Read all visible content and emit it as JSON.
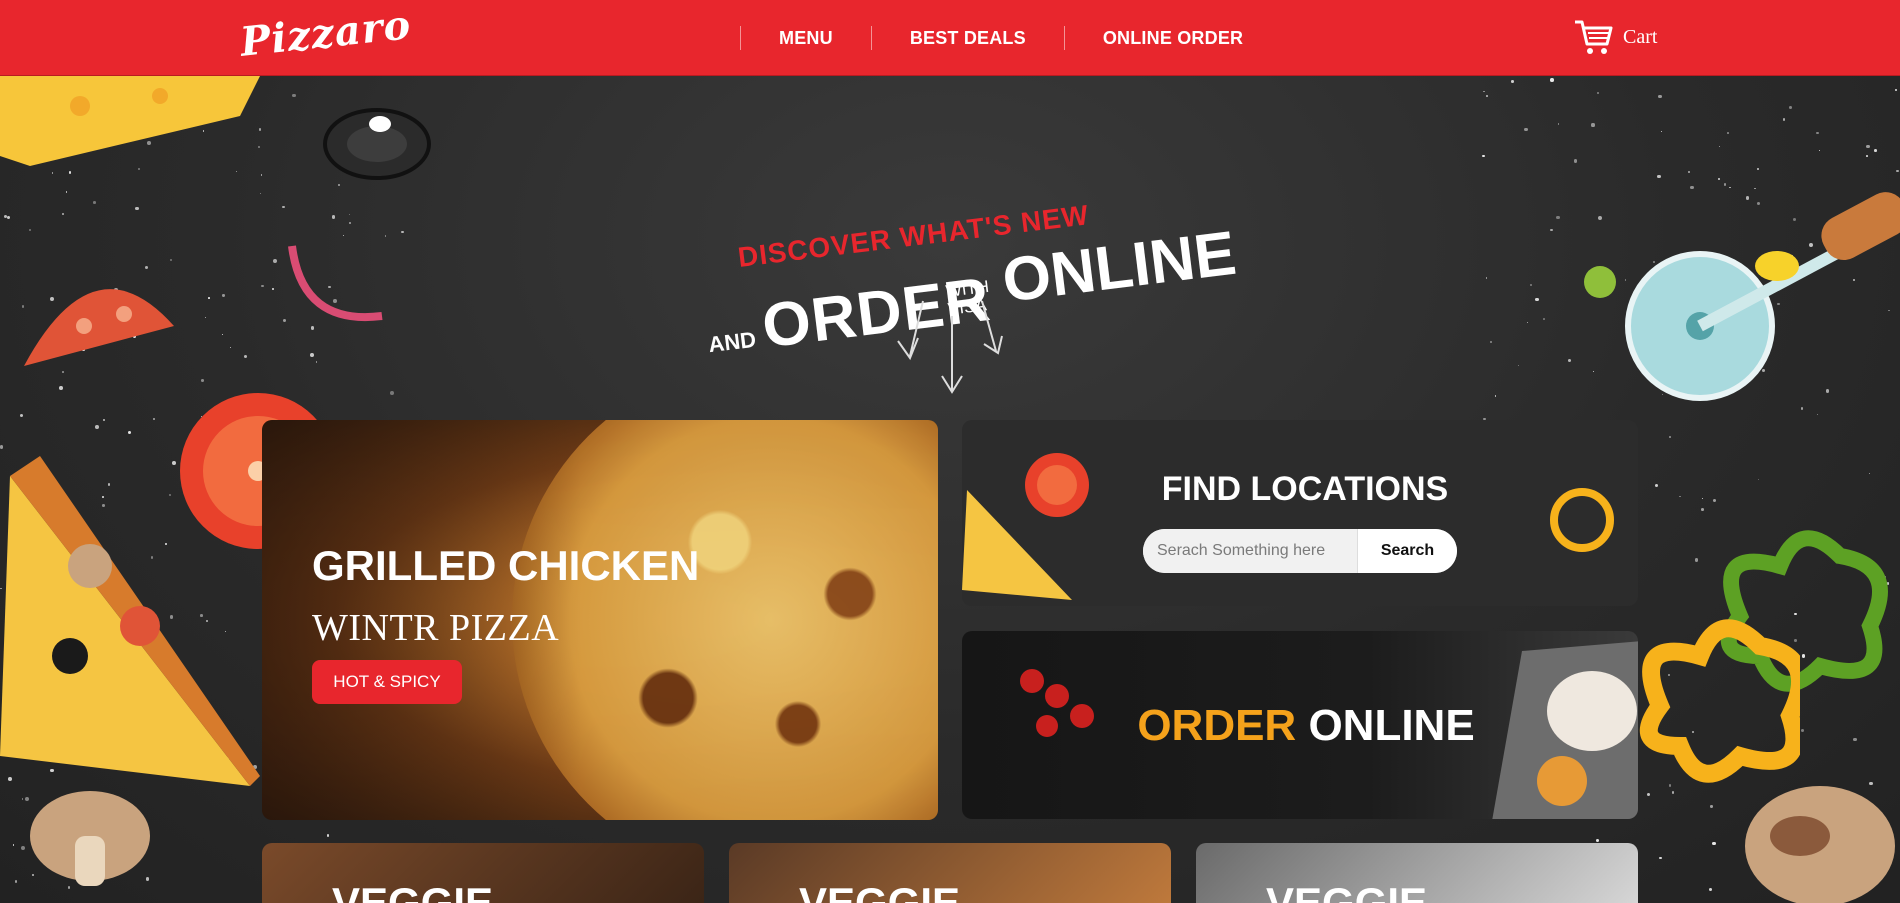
{
  "header": {
    "logo": "Pizzaro",
    "nav": [
      "MENU",
      "BEST DEALS",
      "ONLINE ORDER"
    ],
    "cart_label": "Cart",
    "cart_icon": "cart-icon"
  },
  "hero": {
    "line1": "DISCOVER WHAT'S NEW",
    "and": "AND",
    "order": "ORDER",
    "with_visa": "WITH VISA",
    "with": "WITH",
    "visa": "VISA",
    "online": "ONLINE",
    "arrows_icon": "arrows-down-icon"
  },
  "cards": {
    "chicken": {
      "title": "GRILLED CHICKEN",
      "subtitle": "WINTR PIZZA",
      "button": "HOT & SPICY"
    },
    "locations": {
      "title": "FIND LOCATIONS",
      "placeholder": "Serach Something here",
      "search_button": "Search"
    },
    "order_online": {
      "order": "ORDER",
      "online": "ONLINE"
    },
    "bottom": [
      "VEGGIE",
      "VEGGIE",
      "VEGGIE"
    ]
  },
  "colors": {
    "brand_red": "#e8262d",
    "accent_orange": "#f5a21b",
    "background": "#2b2b2b"
  }
}
